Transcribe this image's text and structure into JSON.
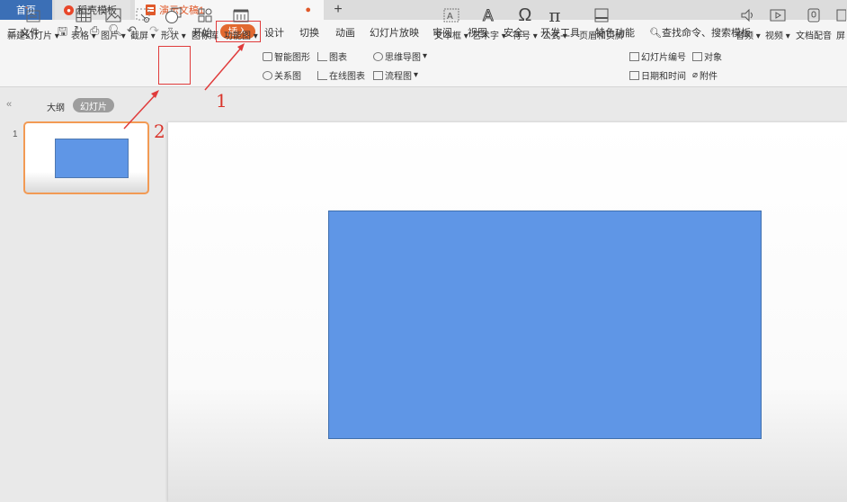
{
  "titlebar": {
    "home_tab": "首页",
    "daoke_tab": "稻壳模板",
    "doc_tab": "演示文稿1",
    "doc_modified": "●",
    "new_tab": "+"
  },
  "menu": {
    "file": "三 文件",
    "items": [
      "开始",
      "插入",
      "设计",
      "切换",
      "动画",
      "幻灯片放映",
      "审阅",
      "视图",
      "安全",
      "开发工具",
      "特色功能"
    ],
    "search": "查找命令、搜索模板"
  },
  "ribbon": {
    "new_slide": "新建幻灯片",
    "table": "表格",
    "picture": "图片",
    "screenshot": "截屏",
    "shape": "形状",
    "icon_lib": "图标库",
    "function_chart": "功能图",
    "smart_art": "智能图形",
    "chart": "图表",
    "relation": "关系图",
    "online_chart": "在线图表",
    "mindmap": "思维导图",
    "flowchart": "流程图",
    "textbox": "文本框",
    "wordart": "艺术字",
    "symbol": "符号",
    "formula": "公式",
    "header_footer": "页眉和页脚",
    "slide_number": "幻灯片编号",
    "object": "对象",
    "date_time": "日期和时间",
    "attachment": "附件",
    "audio": "音频",
    "video": "视频",
    "doc_dub": "文档配音",
    "screen": "屏"
  },
  "leftpanel": {
    "collapse": "«",
    "outline": "大纲",
    "slides": "幻灯片",
    "slide_number": "1"
  },
  "annotations": {
    "step1": "1",
    "step2": "2"
  },
  "colors": {
    "accent": "#e2692f",
    "highlight": "#e03b3b",
    "shape_fill": "#5f96e6",
    "home_tab": "#3b6fb6"
  }
}
